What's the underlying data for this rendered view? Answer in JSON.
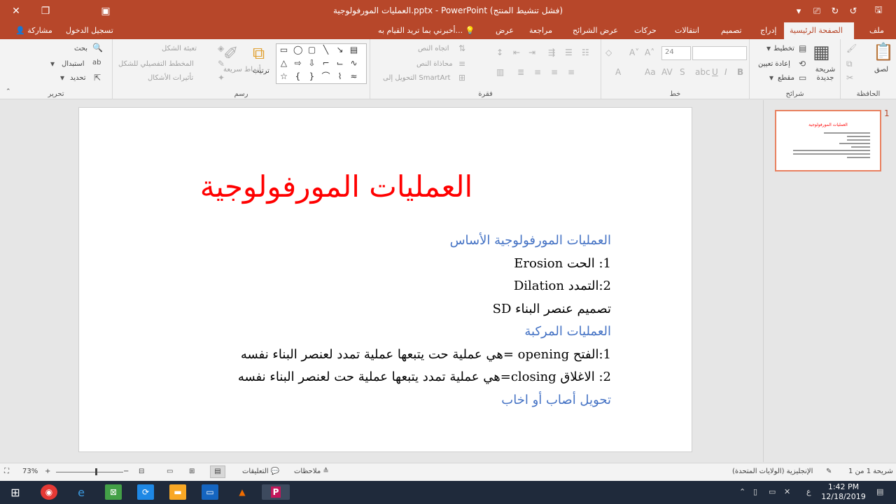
{
  "window": {
    "title": "العمليات المورفولوجية.pptx - PowerPoint (فشل تنشيط المنتج)",
    "sign_in": "تسجيل الدخول",
    "share": "مشاركة"
  },
  "tabs": [
    "ملف",
    "الصفحة الرئيسية",
    "إدراج",
    "تصميم",
    "انتقالات",
    "حركات",
    "عرض الشرائح",
    "مراجعة",
    "عرض"
  ],
  "tell_me": "أخبرني بما تريد القيام به...",
  "ribbon": {
    "clipboard": {
      "label": "الحافظة",
      "paste": "لصق"
    },
    "slides": {
      "label": "شرائح",
      "new_slide": "شريحة جديدة",
      "layout": "تخطيط",
      "reset": "إعادة تعيين",
      "section": "مقطع"
    },
    "font": {
      "label": "خط",
      "size": "24"
    },
    "paragraph": {
      "label": "فقرة",
      "text_direction": "اتجاه النص",
      "align_text": "محاذاة النص",
      "smartart": "التحويل إلى SmartArt"
    },
    "drawing": {
      "label": "رسم",
      "arrange": "ترتيب",
      "quick_styles": "أنماط سريعة",
      "shape_fill": "تعبئة الشكل",
      "shape_outline": "المخطط التفصيلي للشكل",
      "shape_effects": "تأثيرات الأشكال"
    },
    "editing": {
      "label": "تحرير",
      "find": "بحث",
      "replace": "استبدال",
      "select": "تحديد"
    }
  },
  "slide": {
    "title": "العمليات المورفولوجية",
    "lines": [
      "العمليات المورفولوجية الأساس",
      "1: الحت Erosion",
      "2:التمدد Dilation",
      "تصميم عنصر البناء SD",
      "العمليات المركبة",
      "1:الفتح opening =هي عملية حت يتبعها عملية تمدد لعنصر البناء نفسه",
      "2: الاغلاق closing=هي عملية تمدد يتبعها عملية حت لعنصر البناء نفسه",
      "تحويل أصاب أو اخاب"
    ]
  },
  "thumbnail": {
    "number": "1"
  },
  "status": {
    "slide_count": "شريحة 1 من 1",
    "language": "الإنجليزية (الولايات المتحدة)",
    "notes": "ملاحظات",
    "comments": "التعليقات",
    "zoom": "73%"
  },
  "taskbar": {
    "time": "1:42 PM",
    "date": "12/18/2019",
    "lang": "ع"
  },
  "colors": {
    "accent": "#b7472a",
    "title_red": "#ff0000",
    "body_blue": "#4472c4"
  }
}
